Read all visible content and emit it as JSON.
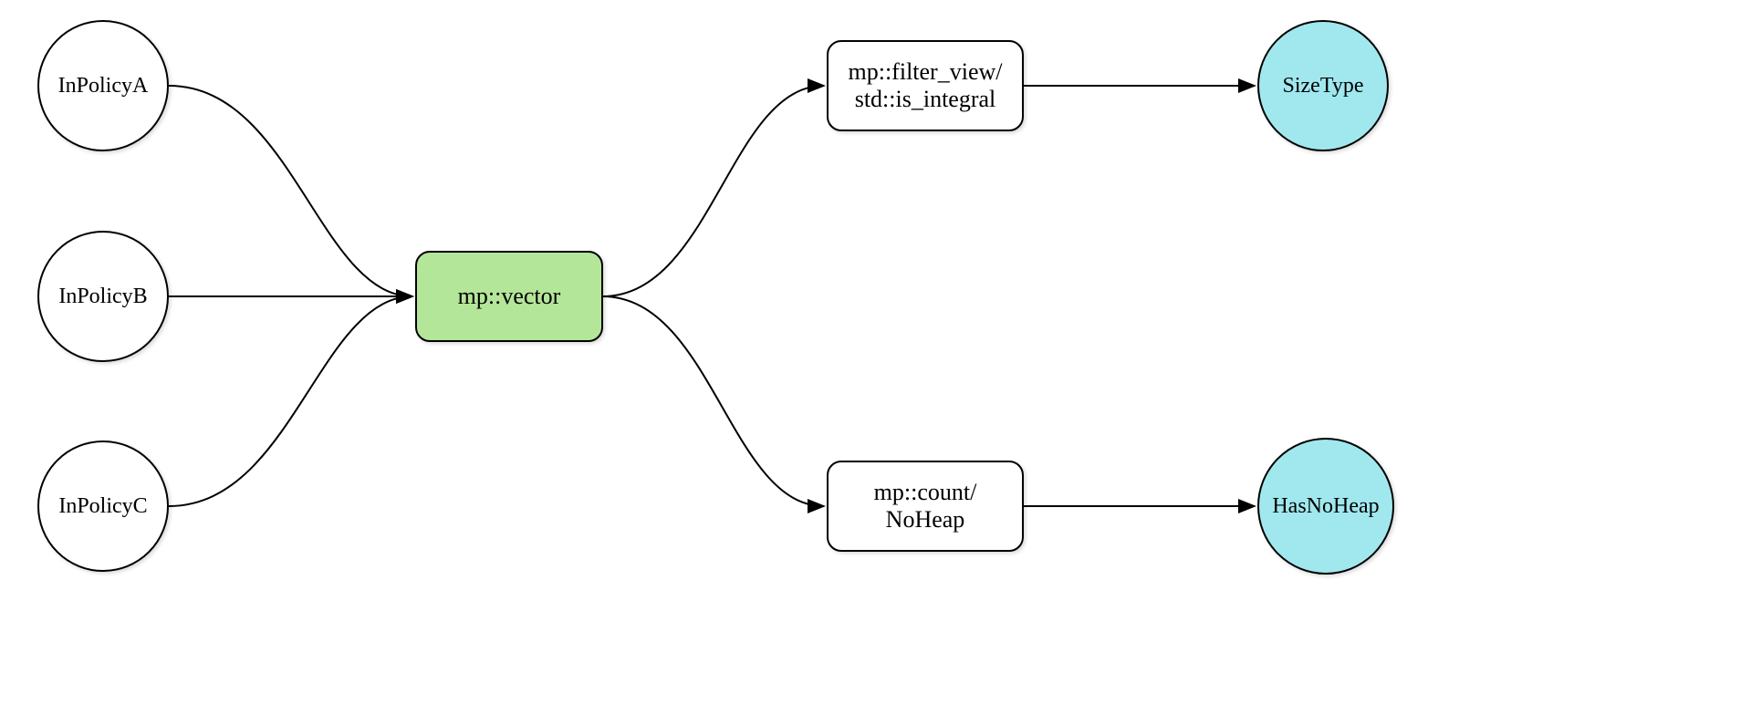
{
  "nodes": {
    "inPolicyA": "InPolicyA",
    "inPolicyB": "InPolicyB",
    "inPolicyC": "InPolicyC",
    "mpVector": "mp::vector",
    "filterView": "mp::filter_view/\nstd::is_integral",
    "countNoHeap": "mp::count/\nNoHeap",
    "sizeType": "SizeType",
    "hasNoHeap": "HasNoHeap"
  }
}
